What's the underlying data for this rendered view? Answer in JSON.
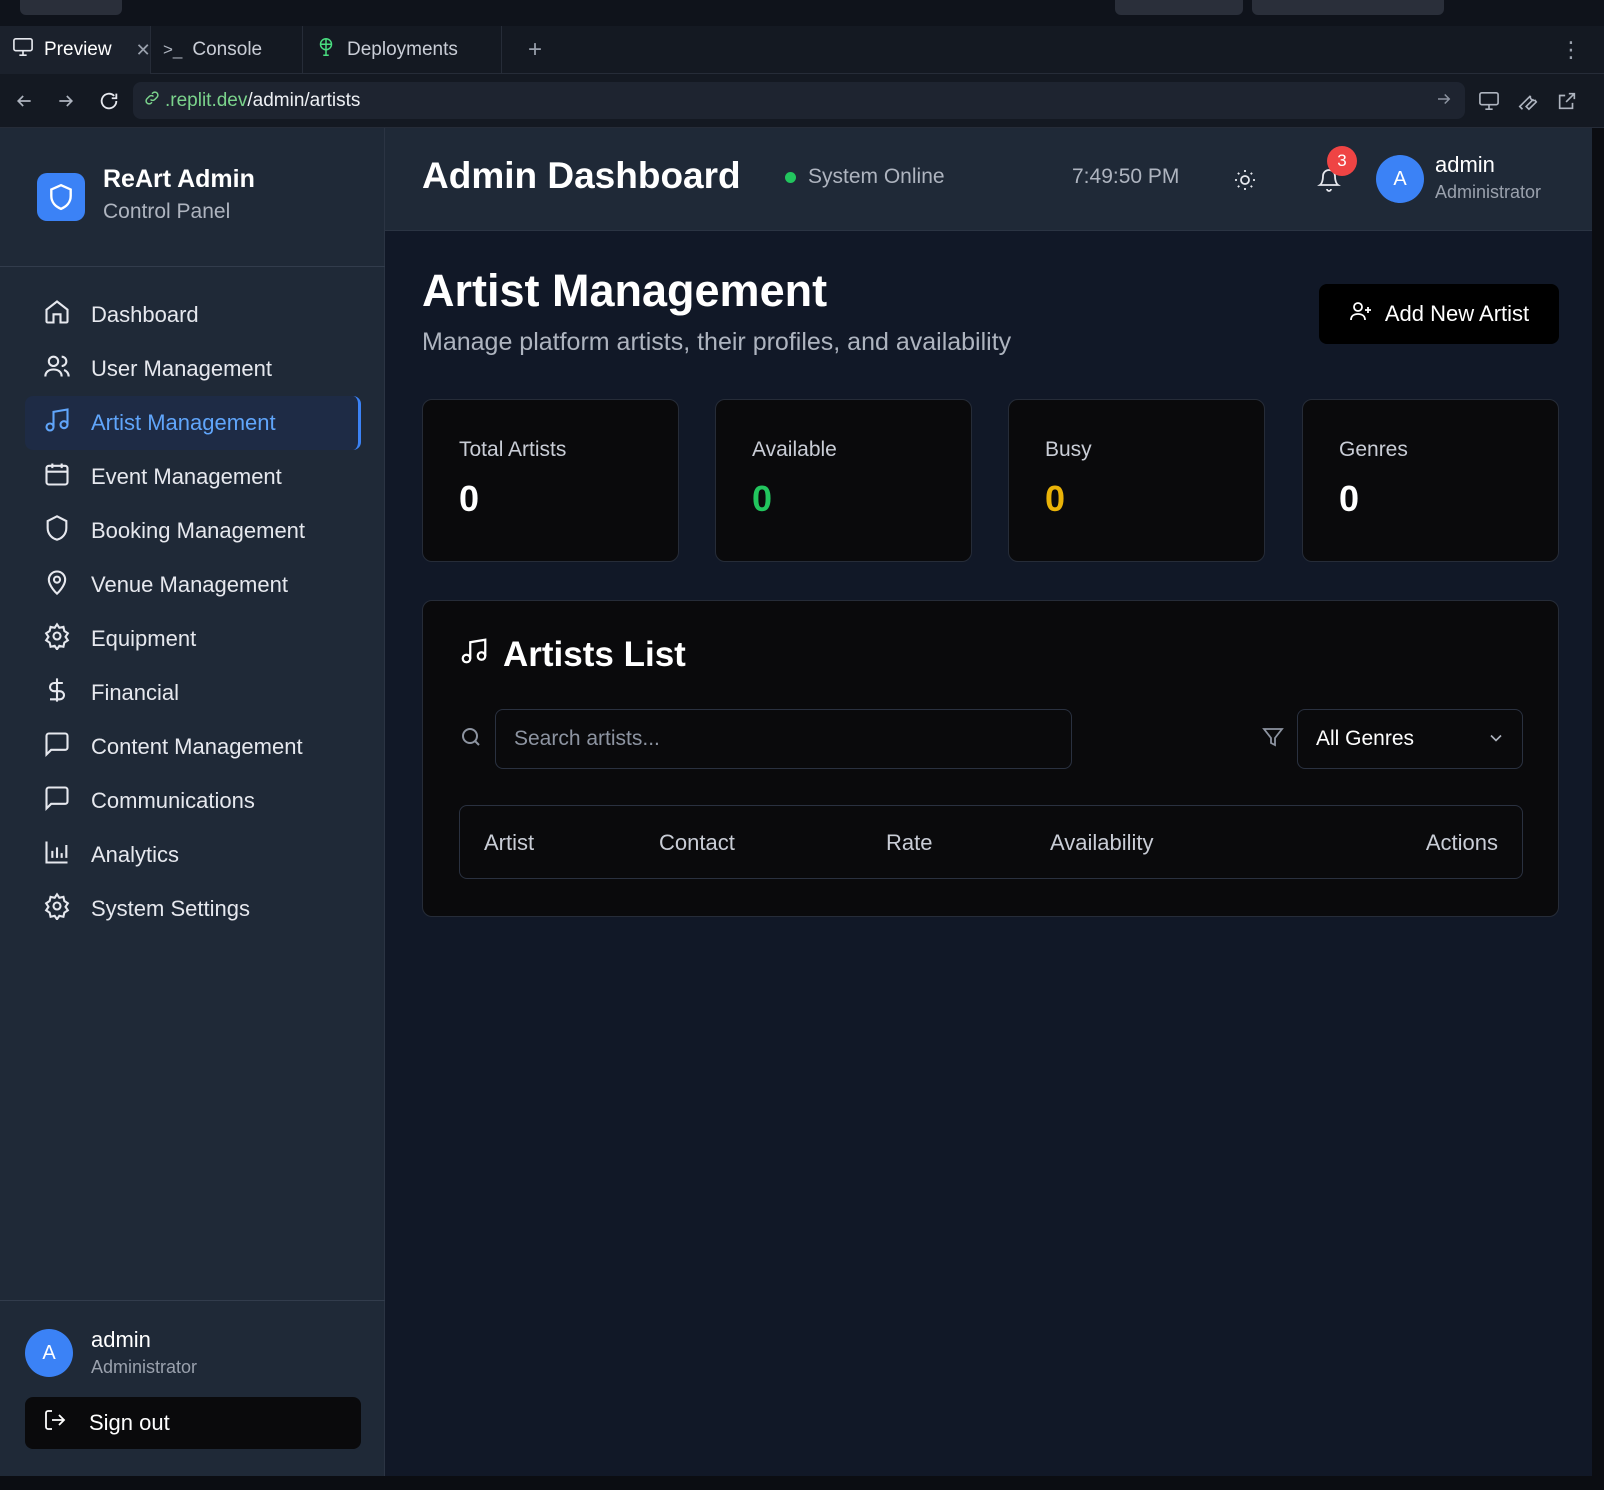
{
  "browser": {
    "tabs": [
      {
        "label": "Preview",
        "icon": "monitor-icon",
        "active": true,
        "closable": true
      },
      {
        "label": "Console",
        "icon": "terminal-icon"
      },
      {
        "label": "Deployments",
        "icon": "deploy-icon"
      }
    ],
    "new_tab": "+",
    "menu": "⋮",
    "url": {
      "host": ".replit.dev",
      "path": "/admin/artists"
    }
  },
  "sidebar": {
    "brand": {
      "title": "ReArt Admin",
      "subtitle": "Control Panel",
      "icon": "shield-icon"
    },
    "items": [
      {
        "label": "Dashboard",
        "icon": "home-icon"
      },
      {
        "label": "User Management",
        "icon": "users-icon"
      },
      {
        "label": "Artist Management",
        "icon": "music-icon",
        "active": true
      },
      {
        "label": "Event Management",
        "icon": "calendar-icon"
      },
      {
        "label": "Booking Management",
        "icon": "shield-icon"
      },
      {
        "label": "Venue Management",
        "icon": "map-pin-icon"
      },
      {
        "label": "Equipment",
        "icon": "gear-icon"
      },
      {
        "label": "Financial",
        "icon": "dollar-icon"
      },
      {
        "label": "Content Management",
        "icon": "message-icon"
      },
      {
        "label": "Communications",
        "icon": "message-icon"
      },
      {
        "label": "Analytics",
        "icon": "bar-chart-icon"
      },
      {
        "label": "System Settings",
        "icon": "gear-icon"
      }
    ],
    "user": {
      "initial": "A",
      "name": "admin",
      "role": "Administrator"
    },
    "signout_label": "Sign out"
  },
  "header": {
    "title": "Admin Dashboard",
    "status": "System Online",
    "time": "7:49:50 PM",
    "notifications": "3",
    "user": {
      "initial": "A",
      "name": "admin",
      "role": "Administrator"
    }
  },
  "main": {
    "title": "Artist Management",
    "subtitle": "Manage platform artists, their profiles, and availability",
    "add_button": "Add New Artist",
    "stats": [
      {
        "label": "Total Artists",
        "value": "0",
        "color": "#ffffff"
      },
      {
        "label": "Available",
        "value": "0",
        "color": "#22c55e"
      },
      {
        "label": "Busy",
        "value": "0",
        "color": "#eab308"
      },
      {
        "label": "Genres",
        "value": "0",
        "color": "#ffffff"
      }
    ],
    "list": {
      "title": "Artists List",
      "search_placeholder": "Search artists...",
      "genre_filter": "All Genres",
      "columns": [
        "Artist",
        "Contact",
        "Rate",
        "Availability",
        "Actions"
      ]
    }
  },
  "colors": {
    "accent": "#3b82f6",
    "available": "#22c55e",
    "busy": "#eab308",
    "badge": "#ef4444"
  }
}
